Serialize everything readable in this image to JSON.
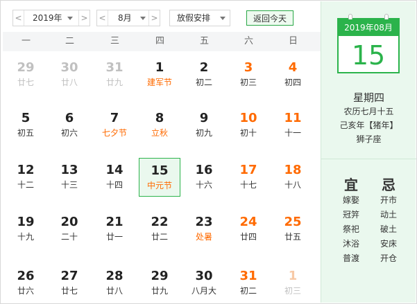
{
  "toolbar": {
    "year": "2019年",
    "month": "8月",
    "holiday": "放假安排",
    "today_btn": "返回今天",
    "prev": "<",
    "next": ">"
  },
  "weekdays": [
    "一",
    "二",
    "三",
    "四",
    "五",
    "六",
    "日"
  ],
  "weeks": [
    [
      {
        "day": "29",
        "lunar": "廿七",
        "type": "other"
      },
      {
        "day": "30",
        "lunar": "廿八",
        "type": "other"
      },
      {
        "day": "31",
        "lunar": "廿九",
        "type": "other"
      },
      {
        "day": "1",
        "lunar": "建军节",
        "type": "festival"
      },
      {
        "day": "2",
        "lunar": "初二",
        "type": "normal"
      },
      {
        "day": "3",
        "lunar": "初三",
        "type": "weekend"
      },
      {
        "day": "4",
        "lunar": "初四",
        "type": "weekend"
      }
    ],
    [
      {
        "day": "5",
        "lunar": "初五",
        "type": "normal"
      },
      {
        "day": "6",
        "lunar": "初六",
        "type": "normal"
      },
      {
        "day": "7",
        "lunar": "七夕节",
        "type": "festival"
      },
      {
        "day": "8",
        "lunar": "立秋",
        "type": "festival"
      },
      {
        "day": "9",
        "lunar": "初九",
        "type": "normal"
      },
      {
        "day": "10",
        "lunar": "初十",
        "type": "weekend"
      },
      {
        "day": "11",
        "lunar": "十一",
        "type": "weekend"
      }
    ],
    [
      {
        "day": "12",
        "lunar": "十二",
        "type": "normal"
      },
      {
        "day": "13",
        "lunar": "十三",
        "type": "normal"
      },
      {
        "day": "14",
        "lunar": "十四",
        "type": "normal"
      },
      {
        "day": "15",
        "lunar": "中元节",
        "type": "selected"
      },
      {
        "day": "16",
        "lunar": "十六",
        "type": "normal"
      },
      {
        "day": "17",
        "lunar": "十七",
        "type": "weekend"
      },
      {
        "day": "18",
        "lunar": "十八",
        "type": "weekend"
      }
    ],
    [
      {
        "day": "19",
        "lunar": "十九",
        "type": "normal"
      },
      {
        "day": "20",
        "lunar": "二十",
        "type": "normal"
      },
      {
        "day": "21",
        "lunar": "廿一",
        "type": "normal"
      },
      {
        "day": "22",
        "lunar": "廿二",
        "type": "normal"
      },
      {
        "day": "23",
        "lunar": "处暑",
        "type": "festival"
      },
      {
        "day": "24",
        "lunar": "廿四",
        "type": "weekend"
      },
      {
        "day": "25",
        "lunar": "廿五",
        "type": "weekend"
      }
    ],
    [
      {
        "day": "26",
        "lunar": "廿六",
        "type": "normal"
      },
      {
        "day": "27",
        "lunar": "廿七",
        "type": "normal"
      },
      {
        "day": "28",
        "lunar": "廿八",
        "type": "normal"
      },
      {
        "day": "29",
        "lunar": "廿九",
        "type": "normal"
      },
      {
        "day": "30",
        "lunar": "八月大",
        "type": "normal"
      },
      {
        "day": "31",
        "lunar": "初二",
        "type": "weekend"
      },
      {
        "day": "1",
        "lunar": "初三",
        "type": "other-weekend"
      }
    ]
  ],
  "detail": {
    "header": "2019年08月",
    "day": "15",
    "weekday": "星期四",
    "lunar_date": "农历七月十五",
    "ganzhi": "己亥年【猪年】",
    "zodiac": "狮子座"
  },
  "yi": {
    "title": "宜",
    "items": [
      "嫁娶",
      "冠笄",
      "祭祀",
      "沐浴",
      "普渡"
    ]
  },
  "ji": {
    "title": "忌",
    "items": [
      "开市",
      "动土",
      "破土",
      "安床",
      "开仓"
    ]
  },
  "colors": {
    "accent": "#2bb34b",
    "festival": "#ff6a00",
    "weekend": "#ff6a00",
    "muted": "#c0c0c0"
  }
}
